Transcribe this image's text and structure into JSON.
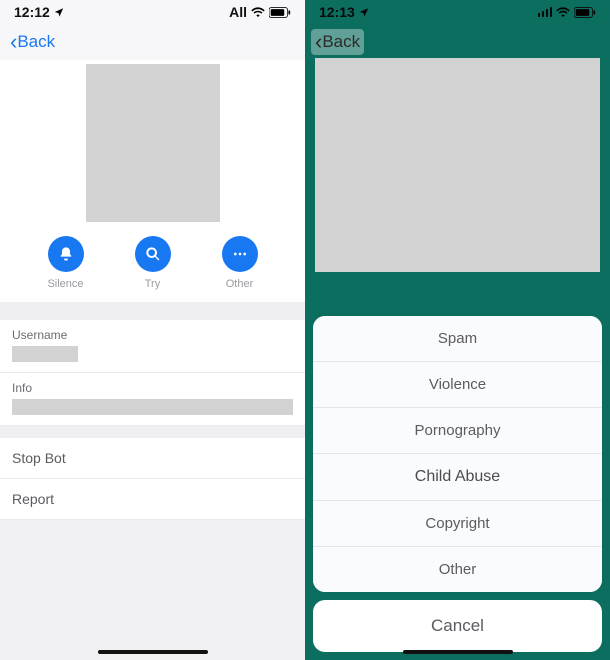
{
  "left": {
    "status": {
      "time": "12:12",
      "carrier": "All"
    },
    "nav": {
      "back": "Back"
    },
    "actions": {
      "silence": "Silence",
      "try": "Try",
      "other": "Other"
    },
    "fields": {
      "username_label": "Username",
      "info_label": "Info"
    },
    "rows": {
      "stop_bot": "Stop Bot",
      "report": "Report"
    }
  },
  "right": {
    "status": {
      "time": "12:13"
    },
    "nav": {
      "back": "Back"
    },
    "sheet": {
      "items": {
        "spam": "Spam",
        "violence": "Violence",
        "pornography": "Pornography",
        "child_abuse": "Child Abuse",
        "copyright": "Copyright",
        "other": "Other"
      },
      "cancel": "Cancel"
    }
  },
  "colors": {
    "accent_blue": "#1878f2",
    "teal": "#0b6e5e"
  }
}
